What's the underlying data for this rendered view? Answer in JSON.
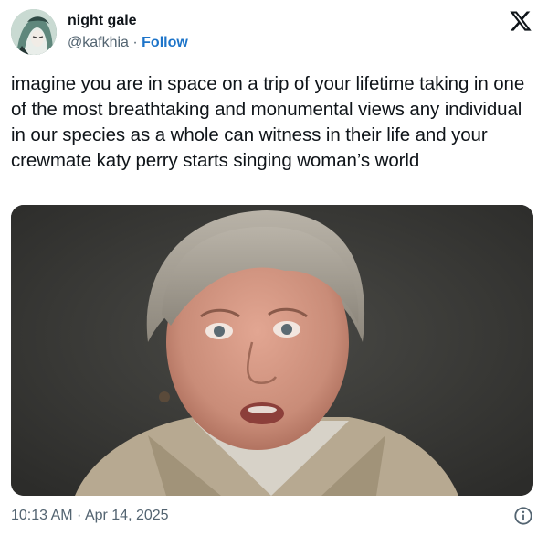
{
  "author": {
    "display_name": "night gale",
    "handle": "@kafkhia",
    "separator": " · ",
    "follow_label": "Follow"
  },
  "tweet": {
    "text": "imagine you are in space on a trip of your lifetime taking in one of the most breathtaking and monumental views any individual in our species as a whole can witness in their life and your crewmate katy perry starts singing woman’s world"
  },
  "footer": {
    "timestamp": "10:13 AM · Apr 14, 2025"
  },
  "icons": {
    "platform": "x-logo-icon",
    "info": "info-icon"
  },
  "colors": {
    "text_primary": "#0f1419",
    "text_secondary": "#536471",
    "link": "#1d74c9"
  }
}
